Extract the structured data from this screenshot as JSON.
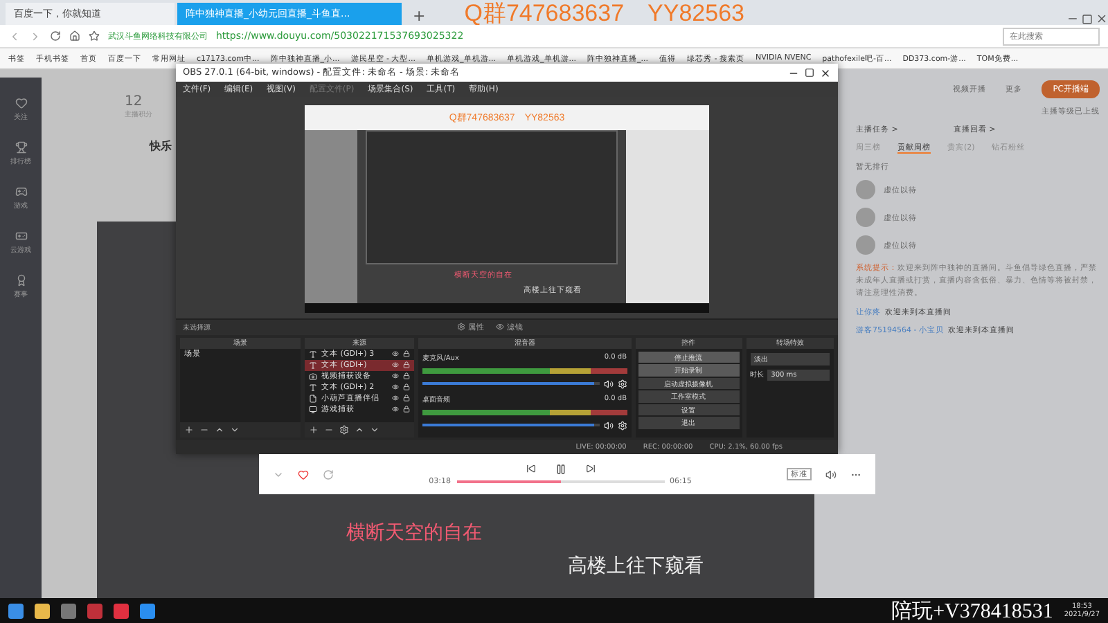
{
  "browser": {
    "tabs": [
      {
        "label": "百度一下，你就知道",
        "selected": false
      },
      {
        "label": "阵中独神直播_小幼元回直播_斗鱼直...",
        "selected": true
      }
    ],
    "new_tab": "+",
    "overlay_text": "Q群747683637　YY82563",
    "site_badge": "武汉斗鱼网络科技有限公司",
    "url": "https://www.douyu.com/503022171537693025322",
    "search_placeholder": "在此搜索",
    "bookmarks": [
      "书签",
      "手机书签",
      "首页",
      "百度一下",
      "常用网址",
      "c17173.com中...",
      "阵中独神直播_小...",
      "游民星空 - 大型...",
      "单机游戏_单机游...",
      "单机游戏_单机游...",
      "阵中独神直播_...",
      "值得",
      "绿芯秀 - 搜索页",
      "NVIDIA NVENC",
      "pathofexile吧-百...",
      "DD373.com-游...",
      "TOM免费..."
    ]
  },
  "page": {
    "nav": [
      "关注",
      "排行榜",
      "游戏",
      "云游戏",
      "赛事"
    ],
    "score": {
      "value": "12",
      "label": "主播积分"
    },
    "streamer_title": "快乐",
    "lyrics": [
      {
        "text": "横断天空的自在",
        "kind": "current"
      },
      {
        "text": "高楼上往下窥看",
        "kind": "next"
      }
    ],
    "side": {
      "actions": [
        "视频开播",
        "更多"
      ],
      "pc_button": "PC开播端",
      "pc_note": "主播等级已上线",
      "links": [
        "主播任务 >",
        "直播回看 >"
      ],
      "rank_tabs": [
        {
          "label": "周三榜",
          "selected": false
        },
        {
          "label": "贡献周榜",
          "selected": true
        },
        {
          "label": "贵宾(2)",
          "selected": false
        },
        {
          "label": "钻石粉丝",
          "selected": false
        }
      ],
      "rank_title": "暂无排行",
      "rank_items": [
        "虚位以待",
        "虚位以待",
        "虚位以待"
      ],
      "system_label": "系统提示：",
      "system_text": "欢迎来到阵中独神的直播间。斗鱼倡导绿色直播，严禁未成年人直播或打赏，直播内容含低俗、暴力、色情等将被封禁，请注意理性消费。",
      "chat": [
        {
          "user": "让你疼",
          "text": "欢迎来到本直播间"
        },
        {
          "user": "游客75194564 - 小宝贝",
          "text": "欢迎来到本直播间"
        }
      ]
    }
  },
  "obs": {
    "title": "OBS 27.0.1 (64-bit, windows) - 配置文件: 未命名 - 场景: 未命名",
    "menu": [
      {
        "label": "文件(F)",
        "disabled": false
      },
      {
        "label": "编辑(E)",
        "disabled": false
      },
      {
        "label": "视图(V)",
        "disabled": false
      },
      {
        "label": "配置文件(P)",
        "disabled": true
      },
      {
        "label": "场景集合(S)",
        "disabled": false
      },
      {
        "label": "工具(T)",
        "disabled": false
      },
      {
        "label": "帮助(H)",
        "disabled": false
      }
    ],
    "preview": {
      "overlay_text": "Q群747683637　YY82563",
      "lyrics": [
        "横断天空的自在",
        "高楼上往下窥看"
      ]
    },
    "source_bar": {
      "label": "未选择源",
      "buttons": [
        "属性",
        "滤镜"
      ]
    },
    "scenes": {
      "title": "场景",
      "items": [
        {
          "label": "场景",
          "selected": false
        }
      ]
    },
    "sources": {
      "title": "来源",
      "items": [
        {
          "label": "文本 (GDI+) 3",
          "kind": "text",
          "selected": false
        },
        {
          "label": "文本 (GDI+)",
          "kind": "text",
          "selected": true
        },
        {
          "label": "视频捕获设备",
          "kind": "camera",
          "selected": false
        },
        {
          "label": "文本 (GDI+) 2",
          "kind": "text",
          "selected": false
        },
        {
          "label": "小葫芦直播伴侣",
          "kind": "file",
          "selected": false
        },
        {
          "label": "游戏捕获",
          "kind": "game",
          "selected": false
        }
      ]
    },
    "mixer": {
      "title": "混音器",
      "channels": [
        {
          "name": "麦克风/Aux",
          "reading": "0.0 dB",
          "level": 0.97
        },
        {
          "name": "桌面音频",
          "reading": "0.0 dB",
          "level": 0.97
        }
      ]
    },
    "controls": {
      "title": "控件",
      "buttons": [
        "停止推流",
        "开始录制",
        "启动虚拟摄像机",
        "工作室模式",
        "设置",
        "退出"
      ]
    },
    "transitions": {
      "title": "转场特效",
      "type": "淡出",
      "duration_label": "时长",
      "duration": "300 ms"
    },
    "status": [
      "LIVE: 00:00:00",
      "REC: 00:00:00",
      "CPU: 2.1%, 60.00 fps"
    ]
  },
  "player": {
    "elapsed": "03:18",
    "total": "06:15",
    "level": 0.5,
    "quality": "标准"
  },
  "taskbar": {
    "overlay_text": "陪玩+V378418531",
    "time": "18:53",
    "date": "2021/9/27"
  }
}
